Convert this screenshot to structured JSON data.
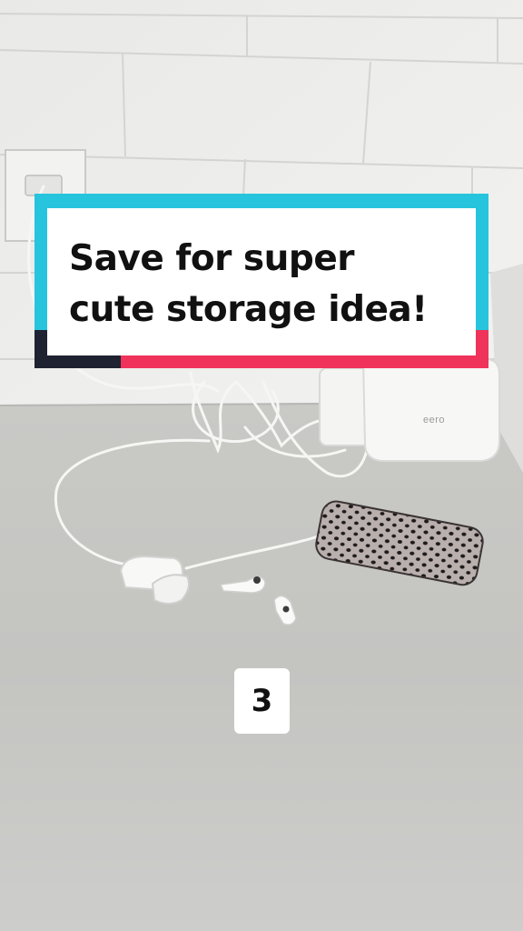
{
  "caption": {
    "line1": "Save for super",
    "line2": "cute storage idea!"
  },
  "router_brand": "eero",
  "counter": "3",
  "colors": {
    "banner_accent_cyan": "#27c4de",
    "banner_accent_pink": "#f0335a",
    "banner_accent_dark": "#1f2230",
    "countertop": "#c8c8c6",
    "tile_wall": "#ececea"
  }
}
